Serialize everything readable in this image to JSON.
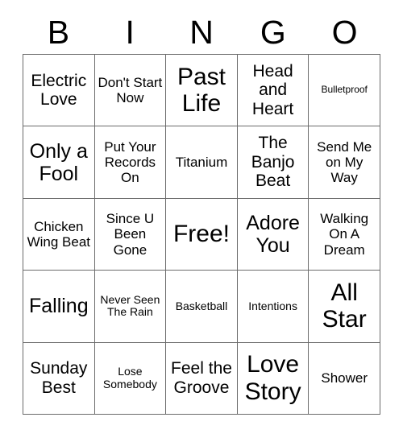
{
  "card": {
    "header_letters": [
      "B",
      "I",
      "N",
      "G",
      "O"
    ],
    "rows": [
      [
        {
          "text": "Electric Love",
          "size": "sz-md"
        },
        {
          "text": "Don't Start Now",
          "size": "sz-sm"
        },
        {
          "text": "Past Life",
          "size": "sz-xl"
        },
        {
          "text": "Head and Heart",
          "size": "sz-md"
        },
        {
          "text": "Bulletproof",
          "size": "sz-xxs"
        }
      ],
      [
        {
          "text": "Only a Fool",
          "size": "sz-lg"
        },
        {
          "text": "Put Your Records On",
          "size": "sz-sm"
        },
        {
          "text": "Titanium",
          "size": "sz-sm"
        },
        {
          "text": "The Banjo Beat",
          "size": "sz-md"
        },
        {
          "text": "Send Me on My Way",
          "size": "sz-sm"
        }
      ],
      [
        {
          "text": "Chicken Wing Beat",
          "size": "sz-sm"
        },
        {
          "text": "Since U Been Gone",
          "size": "sz-sm"
        },
        {
          "text": "Free!",
          "size": "sz-xl"
        },
        {
          "text": "Adore You",
          "size": "sz-lg"
        },
        {
          "text": "Walking On A Dream",
          "size": "sz-sm"
        }
      ],
      [
        {
          "text": "Falling",
          "size": "sz-lg"
        },
        {
          "text": "Never Seen The Rain",
          "size": "sz-xs"
        },
        {
          "text": "Basketball",
          "size": "sz-xs"
        },
        {
          "text": "Intentions",
          "size": "sz-xs"
        },
        {
          "text": "All Star",
          "size": "sz-xl"
        }
      ],
      [
        {
          "text": "Sunday Best",
          "size": "sz-md"
        },
        {
          "text": "Lose Somebody",
          "size": "sz-xs"
        },
        {
          "text": "Feel the Groove",
          "size": "sz-md"
        },
        {
          "text": "Love Story",
          "size": "sz-xl"
        },
        {
          "text": "Shower",
          "size": "sz-sm"
        }
      ]
    ]
  },
  "colors": {
    "background": "#ffffff",
    "text": "#000000",
    "grid_line": "#6b6b6b"
  }
}
